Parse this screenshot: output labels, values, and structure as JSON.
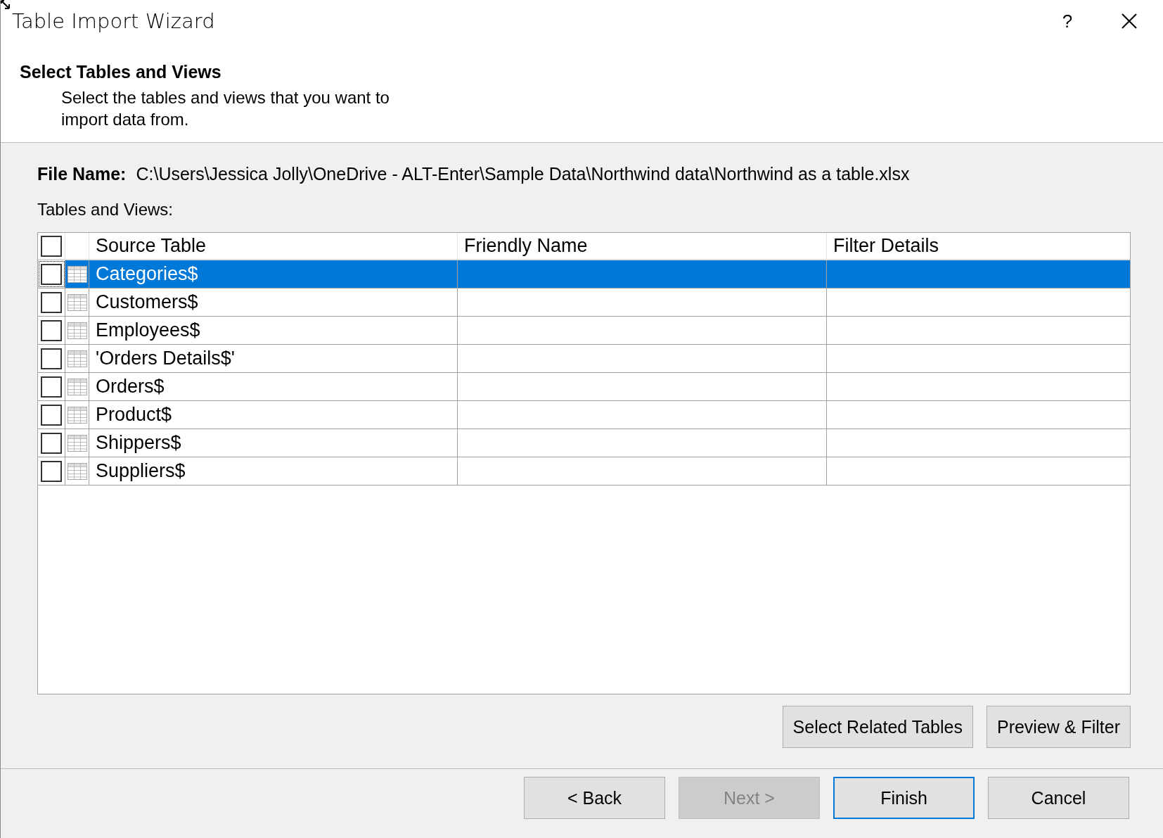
{
  "window": {
    "title": "Table Import Wizard",
    "help": "?"
  },
  "header": {
    "title": "Select Tables and Views",
    "description": "Select the tables and views that you want to import data from."
  },
  "file_name": {
    "label": "File Name:",
    "value": "C:\\Users\\Jessica Jolly\\OneDrive - ALT-Enter\\Sample Data\\Northwind data\\Northwind as a table.xlsx"
  },
  "tables_label": "Tables and Views:",
  "table": {
    "select_all_checked": false,
    "columns": [
      "Source Table",
      "Friendly Name",
      "Filter Details"
    ],
    "rows": [
      {
        "source": "Categories$",
        "checked": false,
        "selected": true
      },
      {
        "source": "Customers$",
        "checked": false,
        "selected": false
      },
      {
        "source": "Employees$",
        "checked": false,
        "selected": false
      },
      {
        "source": "'Orders Details$'",
        "checked": false,
        "selected": false
      },
      {
        "source": "Orders$",
        "checked": false,
        "selected": false
      },
      {
        "source": "Product$",
        "checked": false,
        "selected": false
      },
      {
        "source": "Shippers$",
        "checked": false,
        "selected": false
      },
      {
        "source": "Suppliers$",
        "checked": false,
        "selected": false
      }
    ]
  },
  "table_buttons": [
    "Select Related Tables",
    "Preview & Filter"
  ],
  "footer_buttons": [
    {
      "label": "< Back",
      "disabled": false,
      "default": false
    },
    {
      "label": "Next >",
      "disabled": true,
      "default": false
    },
    {
      "label": "Finish",
      "disabled": false,
      "default": true
    },
    {
      "label": "Cancel",
      "disabled": false,
      "default": false
    }
  ]
}
